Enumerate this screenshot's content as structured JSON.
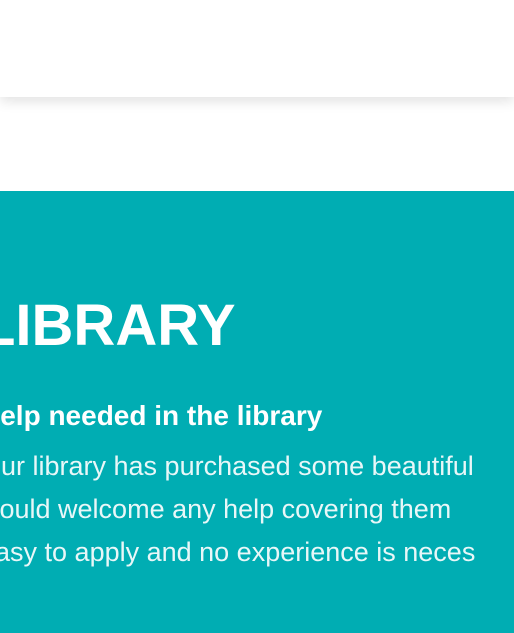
{
  "hero": {
    "title": "LIBRARY",
    "heading": "Help needed in the library",
    "body_lines": [
      "Our library has purchased some beautiful",
      "would  welcome  any  help  covering  them",
      "easy to apply and no experience is neces"
    ]
  },
  "colors": {
    "hero_background": "#00adb3",
    "text": "#ffffff"
  }
}
